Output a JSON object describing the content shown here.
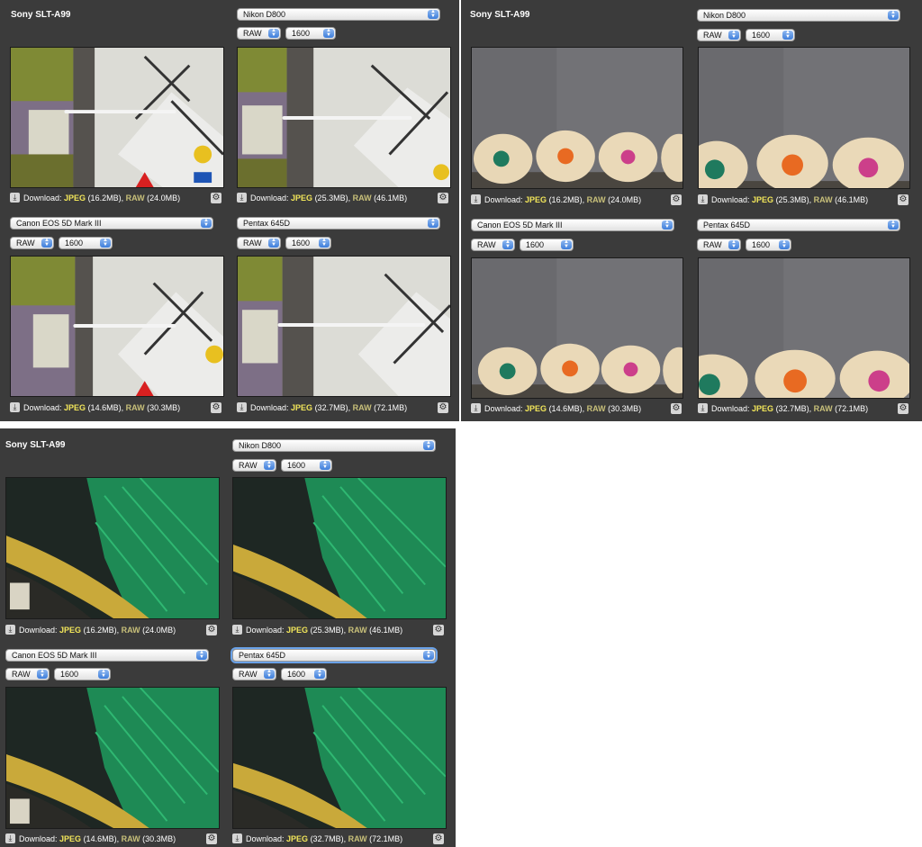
{
  "panels": [
    {
      "title": "Sony SLT-A99",
      "scene": "card",
      "cells": [
        {
          "camera": null,
          "format": null,
          "iso": null,
          "jpeg": "JPEG",
          "jpeg_size": "(16.2MB), ",
          "raw": "RAW",
          "raw_size": "(24.0MB)"
        },
        {
          "camera": "Nikon D800",
          "format": "RAW",
          "iso": "1600",
          "jpeg": "JPEG",
          "jpeg_size": "(25.3MB), ",
          "raw": "RAW",
          "raw_size": "(46.1MB)"
        },
        {
          "camera": "Canon EOS 5D Mark III",
          "format": "RAW",
          "iso": "1600",
          "jpeg": "JPEG",
          "jpeg_size": "(14.6MB), ",
          "raw": "RAW",
          "raw_size": "(30.3MB)"
        },
        {
          "camera": "Pentax 645D",
          "format": "RAW",
          "iso": "1600",
          "jpeg": "JPEG",
          "jpeg_size": "(32.7MB), ",
          "raw": "RAW",
          "raw_size": "(72.1MB)"
        }
      ]
    },
    {
      "title": "Sony SLT-A99",
      "scene": "pencils",
      "cells": [
        {
          "camera": null,
          "format": null,
          "iso": null,
          "jpeg": "JPEG",
          "jpeg_size": "(16.2MB), ",
          "raw": "RAW",
          "raw_size": "(24.0MB)"
        },
        {
          "camera": "Nikon D800",
          "format": "RAW",
          "iso": "1600",
          "jpeg": "JPEG",
          "jpeg_size": "(25.3MB), ",
          "raw": "RAW",
          "raw_size": "(46.1MB)"
        },
        {
          "camera": "Canon EOS 5D Mark III",
          "format": "RAW",
          "iso": "1600",
          "jpeg": "JPEG",
          "jpeg_size": "(14.6MB), ",
          "raw": "RAW",
          "raw_size": "(30.3MB)"
        },
        {
          "camera": "Pentax 645D",
          "format": "RAW",
          "iso": "1600",
          "jpeg": "JPEG",
          "jpeg_size": "(32.7MB), ",
          "raw": "RAW",
          "raw_size": "(72.1MB)"
        }
      ]
    },
    {
      "title": "Sony SLT-A99",
      "scene": "feathers",
      "cells": [
        {
          "camera": null,
          "format": null,
          "iso": null,
          "jpeg": "JPEG",
          "jpeg_size": "(16.2MB), ",
          "raw": "RAW",
          "raw_size": "(24.0MB)"
        },
        {
          "camera": "Nikon D800",
          "format": "RAW",
          "iso": "1600",
          "jpeg": "JPEG",
          "jpeg_size": "(25.3MB), ",
          "raw": "RAW",
          "raw_size": "(46.1MB)"
        },
        {
          "camera": "Canon EOS 5D Mark III",
          "format": "RAW",
          "iso": "1600",
          "jpeg": "JPEG",
          "jpeg_size": "(14.6MB), ",
          "raw": "RAW",
          "raw_size": "(30.3MB)"
        },
        {
          "camera": "Pentax 645D",
          "format": "RAW",
          "iso": "1600",
          "jpeg": "JPEG",
          "jpeg_size": "(32.7MB), ",
          "raw": "RAW",
          "raw_size": "(72.1MB)"
        }
      ]
    }
  ],
  "download_label": "Download: ",
  "icons": {
    "download": "download-icon",
    "settings": "gear-icon",
    "dropdown": "updown-arrow-icon"
  },
  "colors": {
    "panel_bg": "#3b3b3b",
    "jpeg": "#f2e65a",
    "raw": "#c8c07a",
    "select_arrow": "#3d7ddb"
  }
}
